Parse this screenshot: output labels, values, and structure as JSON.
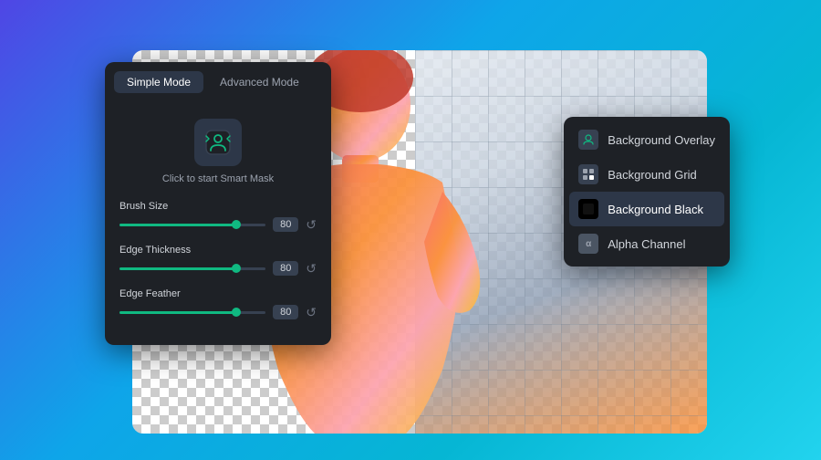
{
  "background": {
    "gradient": "linear-gradient(135deg, #4f46e5, #0ea5e9, #22d3ee)"
  },
  "panel": {
    "tabs": [
      {
        "id": "simple",
        "label": "Simple Mode",
        "active": true
      },
      {
        "id": "advanced",
        "label": "Advanced Mode",
        "active": false
      }
    ],
    "smart_mask_label": "Click to start Smart Mask",
    "sliders": [
      {
        "label": "Brush Size",
        "value": "80",
        "fill_percent": 80
      },
      {
        "label": "Edge Thickness",
        "value": "80",
        "fill_percent": 80
      },
      {
        "label": "Edge Feather",
        "value": "80",
        "fill_percent": 80
      }
    ]
  },
  "dropdown": {
    "items": [
      {
        "id": "overlay",
        "label": "Background Overlay",
        "icon": "person",
        "selected": false
      },
      {
        "id": "grid",
        "label": "Background Grid",
        "icon": "grid",
        "selected": false
      },
      {
        "id": "black",
        "label": "Background Black",
        "icon": "square",
        "selected": true
      },
      {
        "id": "alpha",
        "label": "Alpha Channel",
        "icon": "alpha",
        "selected": false
      }
    ]
  },
  "icons": {
    "reset": "↺",
    "smart_mask": "person-smart"
  }
}
